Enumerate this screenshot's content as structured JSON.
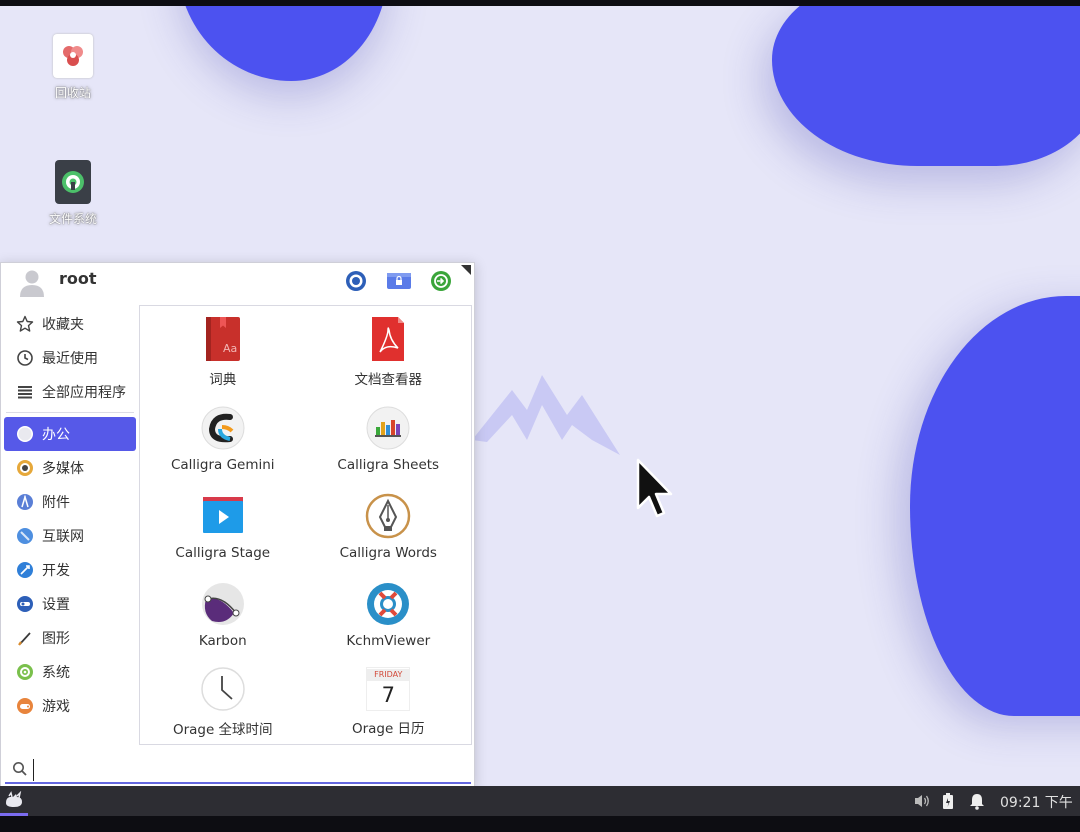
{
  "desktop": {
    "icons": [
      {
        "label": "回收站",
        "icon": "recycle-bin-icon"
      },
      {
        "label": "文件系统",
        "icon": "file-system-icon"
      }
    ]
  },
  "menu": {
    "user": {
      "name": "root",
      "icon": "user-avatar-icon"
    },
    "header_buttons": [
      {
        "icon": "settings-toggle-icon",
        "color": "#2d5fb8"
      },
      {
        "icon": "lock-screen-icon",
        "color": "#5a7be8"
      },
      {
        "icon": "logout-icon",
        "color": "#3aa53a"
      }
    ],
    "quick": [
      {
        "label": "收藏夹",
        "icon": "star-icon"
      },
      {
        "label": "最近使用",
        "icon": "clock-icon"
      },
      {
        "label": "全部应用程序",
        "icon": "list-icon"
      }
    ],
    "categories": [
      {
        "label": "办公",
        "icon": "office-icon",
        "active": true
      },
      {
        "label": "多媒体",
        "icon": "multimedia-icon"
      },
      {
        "label": "附件",
        "icon": "accessories-icon"
      },
      {
        "label": "互联网",
        "icon": "internet-icon"
      },
      {
        "label": "开发",
        "icon": "development-icon"
      },
      {
        "label": "设置",
        "icon": "settings-icon"
      },
      {
        "label": "图形",
        "icon": "graphics-icon"
      },
      {
        "label": "系统",
        "icon": "system-icon"
      },
      {
        "label": "游戏",
        "icon": "games-icon"
      }
    ],
    "apps": [
      {
        "label": "词典",
        "icon": "dictionary-icon"
      },
      {
        "label": "文档查看器",
        "icon": "document-viewer-icon"
      },
      {
        "label": "Calligra Gemini",
        "icon": "calligra-gemini-icon"
      },
      {
        "label": "Calligra Sheets",
        "icon": "calligra-sheets-icon"
      },
      {
        "label": "Calligra Stage",
        "icon": "calligra-stage-icon"
      },
      {
        "label": "Calligra Words",
        "icon": "calligra-words-icon"
      },
      {
        "label": "Karbon",
        "icon": "karbon-icon"
      },
      {
        "label": "KchmViewer",
        "icon": "kchmviewer-icon"
      },
      {
        "label": "Orage 全球时间",
        "icon": "orage-globaltime-icon"
      },
      {
        "label": "Orage 日历",
        "icon": "orage-calendar-icon",
        "calendar_day": "FRIDAY",
        "calendar_date": "7"
      }
    ],
    "search": {
      "value": "",
      "placeholder": "",
      "icon": "search-icon"
    }
  },
  "taskbar": {
    "start_icon": "start-menu-icon",
    "tray": [
      "volume-icon",
      "battery-icon",
      "notification-bell-icon"
    ],
    "clock": "09:21 下午"
  },
  "colors": {
    "accent": "#5659e8",
    "blob": "#4c52f0",
    "desktop_bg": "#e6e6f8",
    "taskbar": "#2d2d33"
  }
}
